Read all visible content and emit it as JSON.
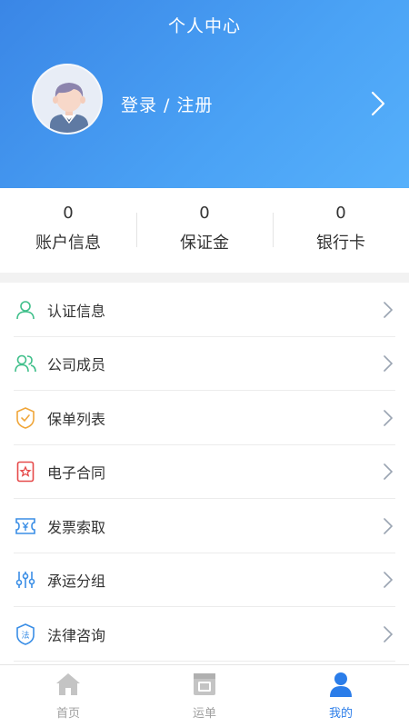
{
  "header": {
    "title": "个人中心",
    "login_label": "登录 / 注册"
  },
  "stats": [
    {
      "value": "0",
      "label": "账户信息"
    },
    {
      "value": "0",
      "label": "保证金"
    },
    {
      "value": "0",
      "label": "银行卡"
    }
  ],
  "menu": [
    {
      "label": "认证信息",
      "icon": "person-icon"
    },
    {
      "label": "公司成员",
      "icon": "members-icon"
    },
    {
      "label": "保单列表",
      "icon": "shield-check-icon"
    },
    {
      "label": "电子合同",
      "icon": "contract-icon"
    },
    {
      "label": "发票索取",
      "icon": "invoice-icon"
    },
    {
      "label": "承运分组",
      "icon": "sliders-icon"
    },
    {
      "label": "法律咨询",
      "icon": "law-icon"
    }
  ],
  "tabbar": [
    {
      "label": "首页",
      "icon": "home-icon"
    },
    {
      "label": "运单",
      "icon": "waybill-icon"
    },
    {
      "label": "我的",
      "icon": "user-icon",
      "active": true
    }
  ],
  "colors": {
    "accent": "#2b7de9",
    "header_gradient_start": "#3a86e6",
    "header_gradient_end": "#56b0fb"
  }
}
